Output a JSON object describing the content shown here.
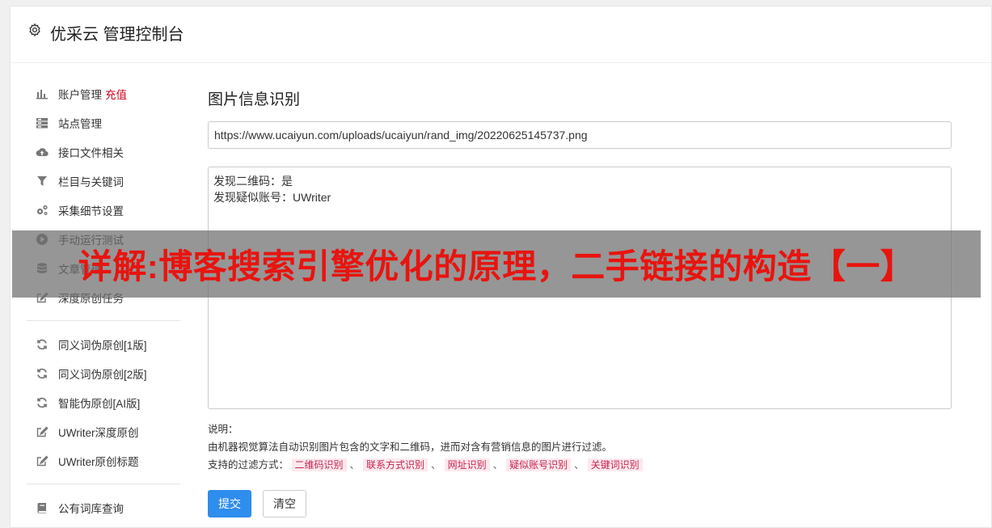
{
  "header": {
    "title": "优采云 管理控制台",
    "icon": "gear-icon"
  },
  "sidebar": {
    "group1": [
      {
        "label": "账户管理",
        "extra": "充值",
        "icon": "bar-chart-icon"
      },
      {
        "label": "站点管理",
        "icon": "server-icon"
      },
      {
        "label": "接口文件相关",
        "icon": "cloud-upload-icon"
      },
      {
        "label": "栏目与关键词",
        "icon": "filter-icon"
      },
      {
        "label": "采集细节设置",
        "icon": "cogs-icon"
      },
      {
        "label": "手动运行测试",
        "icon": "play-circle-icon"
      },
      {
        "label": "文章管理",
        "icon": "database-icon"
      },
      {
        "label": "深度原创任务",
        "icon": "edit-icon"
      }
    ],
    "group2": [
      {
        "label": "同义词伪原创[1版]",
        "icon": "refresh-icon"
      },
      {
        "label": "同义词伪原创[2版]",
        "icon": "refresh-icon"
      },
      {
        "label": "智能伪原创[AI版]",
        "icon": "refresh-icon"
      },
      {
        "label": "UWriter深度原创",
        "icon": "edit-icon"
      },
      {
        "label": "UWriter原创标题",
        "icon": "edit-icon"
      }
    ],
    "group3": [
      {
        "label": "公有词库查询",
        "icon": "book-icon"
      }
    ]
  },
  "main": {
    "title": "图片信息识别",
    "url_value": "https://www.ucaiyun.com/uploads/ucaiyun/rand_img/20220625145737.png",
    "result_text": "发现二维码：是\n发现疑似账号：UWriter",
    "note_label": "说明：",
    "note_desc": "由机器视觉算法自动识别图片包含的文字和二维码，进而对含有营销信息的图片进行过滤。",
    "filter_label": "支持的过滤方式：",
    "filters": [
      "二维码识别",
      "联系方式识别",
      "网址识别",
      "疑似账号识别",
      "关键词识别"
    ],
    "filter_sep": "、",
    "submit_label": "提交",
    "clear_label": "清空"
  },
  "overlay": {
    "text": "详解:博客搜索引擎优化的原理，二手链接的构造【一】"
  },
  "colors": {
    "primary": "#2e8ded",
    "overlay_text": "#e8140f",
    "recharge": "#d0021b",
    "tag_text": "#c7254e",
    "tag_bg": "#fbe9ee"
  }
}
